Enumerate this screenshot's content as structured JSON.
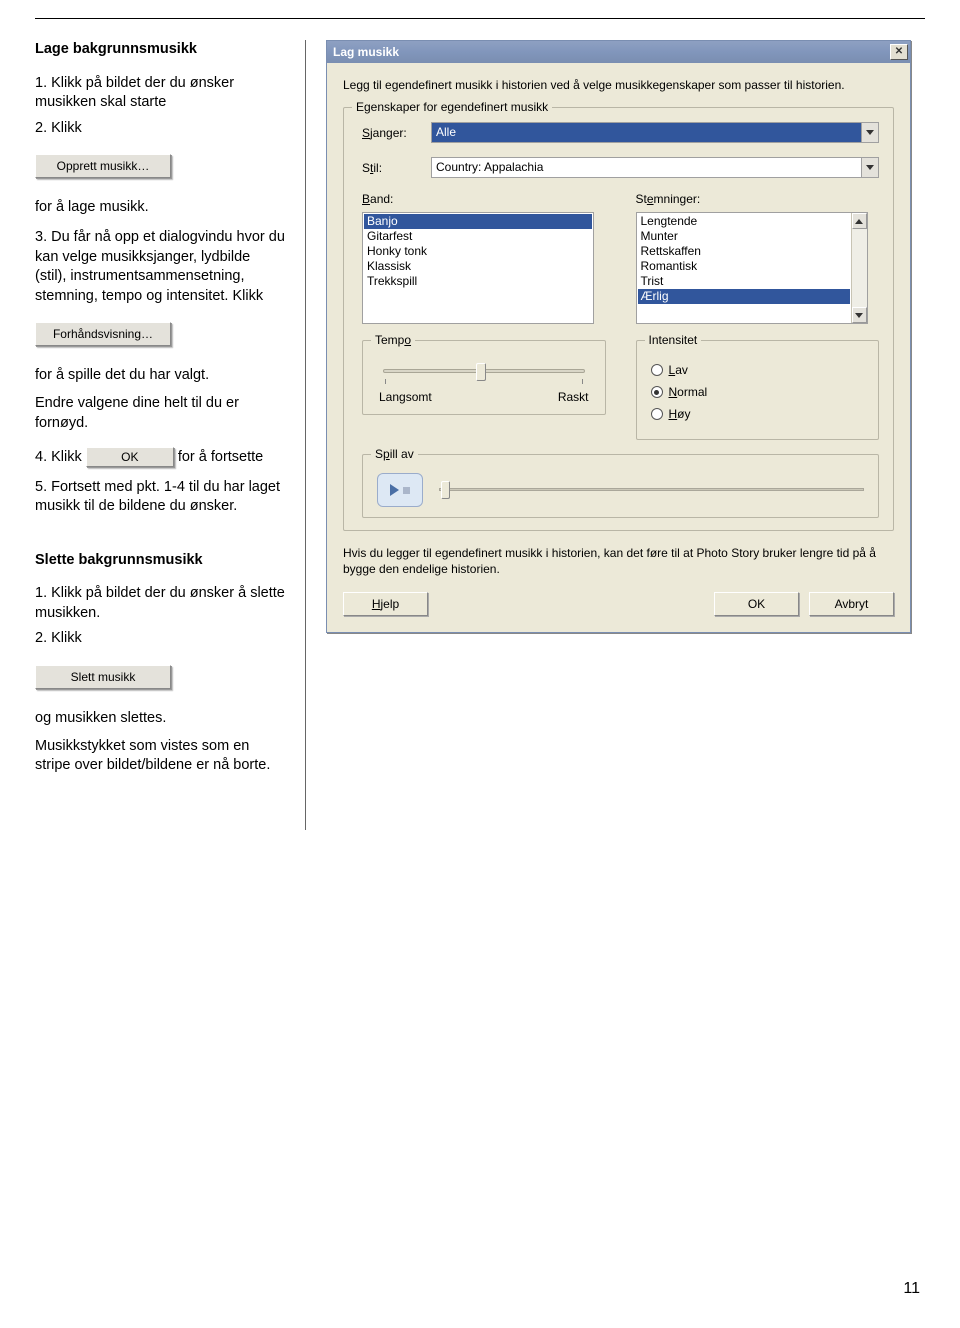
{
  "left": {
    "h1": "Lage bakgrunnsmusikk",
    "s1": "1. Klikk på bildet der du ønsker musikken skal starte",
    "s2": "2.  Klikk",
    "btn_opprett": "Opprett musikk…",
    "s3": "for å lage musikk.",
    "s4": "3. Du får nå opp et dialogvindu hvor du kan velge musikksjanger, lydbilde (stil), instrumentsam­mensetning, stemning, tempo og intensitet. Klikk",
    "btn_forhand": "Forhåndsvisning…",
    "s5": "for å spille det du har valgt.",
    "s6": "Endre valgene dine helt til du er fornøyd.",
    "s7a": "4. Klikk",
    "btn_ok_inline": "OK",
    "s7b": "for å fortsette",
    "s8": "5. Fortsett med pkt. 1-4 til du har laget musikk til de bildene du ønsker.",
    "h2": "Slette bakgrunnsmusikk",
    "d1": "1. Klikk på bildet der du ønsker å slette musikken.",
    "d2": "2.  Klikk",
    "btn_slett": "Slett musikk",
    "d3": "og musikken slettes.",
    "d4": "Musikkstykket som vistes som en stripe over bildet/bildene er nå borte."
  },
  "dlg": {
    "title": "Lag musikk",
    "intro": "Legg til egendefinert musikk i historien ved å velge musikkegenskaper som passer til historien.",
    "group_label": "Egenskaper for egendefinert musikk",
    "sjanger_lbl": "Sjanger:",
    "sjanger_val": "Alle",
    "stil_lbl": "Stil:",
    "stil_val": "Country: Appalachia",
    "band_lbl": "Band:",
    "stem_lbl": "Stemninger:",
    "band_items": [
      "Banjo",
      "Gitarfest",
      "Honky tonk",
      "Klassisk",
      "Trekkspill"
    ],
    "stem_items": [
      "Lengtende",
      "Munter",
      "Rettskaffen",
      "Romantisk",
      "Trist",
      "Ærlig"
    ],
    "tempo_lbl": "Tempo",
    "tempo_left": "Langsomt",
    "tempo_right": "Raskt",
    "intens_lbl": "Intensitet",
    "intens_low": "Lav",
    "intens_normal": "Normal",
    "intens_high": "Høy",
    "spill_lbl": "Spill av",
    "foot": "Hvis du legger til egendefinert musikk i historien, kan det føre til at Photo Story bruker lengre tid på å bygge den endelige historien.",
    "btn_help": "Hjelp",
    "btn_ok": "OK",
    "btn_cancel": "Avbryt"
  },
  "pagenum": "11"
}
